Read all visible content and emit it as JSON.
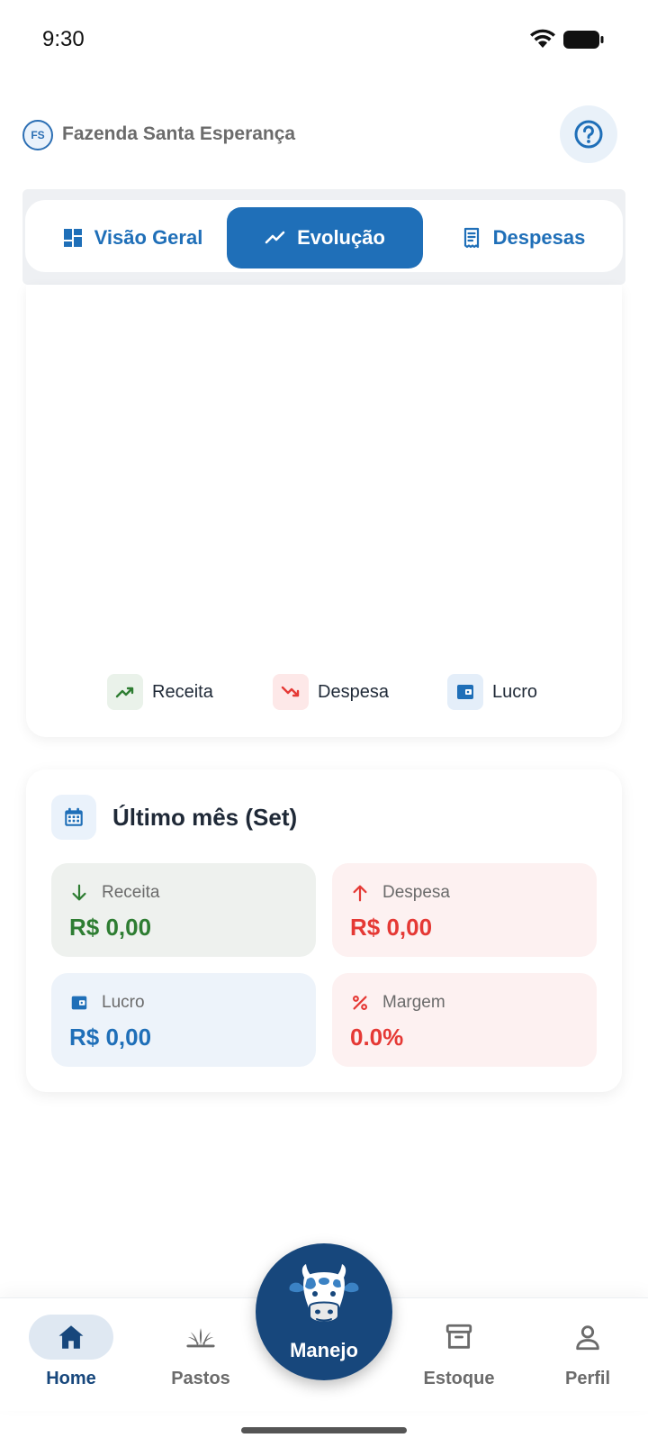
{
  "status_bar": {
    "time": "9:30"
  },
  "header": {
    "farm_initials": "FS",
    "farm_name": "Fazenda Santa Esperança"
  },
  "tabs": [
    {
      "label": "Visão Geral",
      "icon": "dashboard-icon",
      "active": false
    },
    {
      "label": "Evolução",
      "icon": "trending-up-icon",
      "active": true
    },
    {
      "label": "Despesas",
      "icon": "receipt-icon",
      "active": false
    }
  ],
  "chart_legend": [
    {
      "label": "Receita",
      "icon": "trending-up-icon",
      "color": "#2e7d32"
    },
    {
      "label": "Despesa",
      "icon": "trending-down-icon",
      "color": "#e53935"
    },
    {
      "label": "Lucro",
      "icon": "wallet-icon",
      "color": "#1f6fb8"
    }
  ],
  "summary": {
    "title": "Último mês (Set)",
    "receita": {
      "label": "Receita",
      "value": "R$ 0,00",
      "icon": "arrow-down-icon"
    },
    "despesa": {
      "label": "Despesa",
      "value": "R$ 0,00",
      "icon": "arrow-up-icon"
    },
    "lucro": {
      "label": "Lucro",
      "value": "R$ 0,00",
      "icon": "wallet-icon"
    },
    "margem": {
      "label": "Margem",
      "value": "0.0%",
      "icon": "percent-icon"
    }
  },
  "bottom_nav": {
    "home": "Home",
    "pastos": "Pastos",
    "manejo": "Manejo",
    "estoque": "Estoque",
    "perfil": "Perfil"
  },
  "colors": {
    "primary": "#1f6fb8",
    "nav_dark": "#17477c",
    "positive": "#2e7d32",
    "negative": "#e53935"
  }
}
